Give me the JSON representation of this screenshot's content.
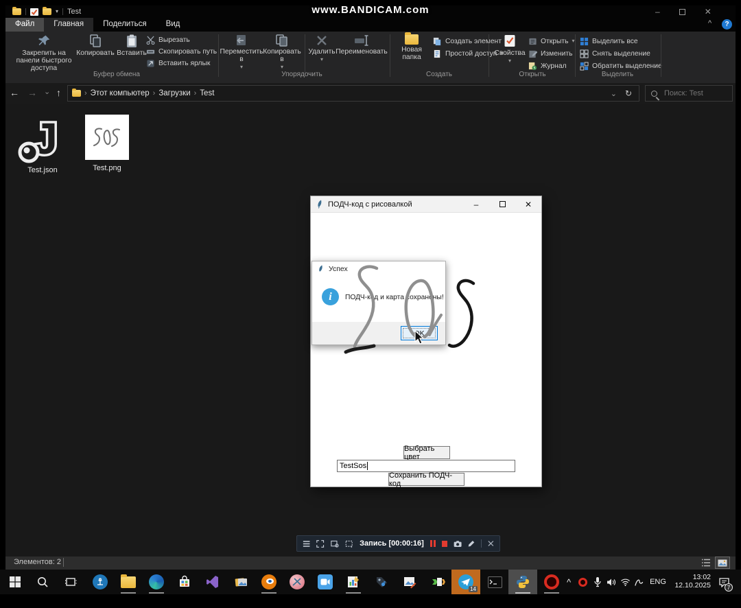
{
  "icons": {
    "minimize": "–",
    "close": "✕",
    "dropdown": "▾",
    "back": "←",
    "forward": "→",
    "up": "↑",
    "refresh": "↻",
    "crumb_sep": "›",
    "help": "?",
    "info": "i",
    "chevron_up": "^",
    "chevron_down": "⌄",
    "json_glyph": "J"
  },
  "titlebar": {
    "title": "Test",
    "watermark": "www.BANDICAM.com"
  },
  "tabs": {
    "file": "Файл",
    "home": "Главная",
    "share": "Поделиться",
    "view": "Вид"
  },
  "ribbon": {
    "groups": [
      {
        "label": "Буфер обмена",
        "buttons": {
          "pin": "Закрепить на панели быстрого доступа",
          "copy": "Копировать",
          "paste": "Вставить",
          "cut": "Вырезать",
          "copy_path": "Скопировать путь",
          "paste_shortcut": "Вставить ярлык"
        }
      },
      {
        "label": "Упорядочить",
        "buttons": {
          "move_to": "Переместить в",
          "copy_to": "Копировать в",
          "delete": "Удалить",
          "rename": "Переименовать"
        }
      },
      {
        "label": "Создать",
        "buttons": {
          "new_folder": "Новая папка",
          "new_item": "Создать элемент",
          "easy_access": "Простой доступ"
        }
      },
      {
        "label": "Открыть",
        "buttons": {
          "properties": "Свойства",
          "open": "Открыть",
          "edit": "Изменить",
          "history": "Журнал"
        }
      },
      {
        "label": "Выделить",
        "buttons": {
          "select_all": "Выделить все",
          "select_none": "Снять выделение",
          "invert": "Обратить выделение"
        }
      }
    ]
  },
  "addressbar": {
    "crumbs": [
      "Этот компьютер",
      "Загрузки",
      "Test"
    ],
    "search_placeholder": "Поиск: Test"
  },
  "files": [
    {
      "name": "Test.json"
    },
    {
      "name": "Test.png",
      "thumb_text": "SOS"
    }
  ],
  "app": {
    "title": "ПОДЧ-код с рисовалкой",
    "drawing_text": "SOS",
    "color_button": "Выбрать цвет",
    "input_value": "TestSos",
    "save_button": "Сохранить ПОДЧ-код",
    "dialog": {
      "title": "Успех",
      "message": "ПОДЧ-код и карта сохранены!",
      "ok": "OK"
    }
  },
  "bandicam": {
    "status": "Запись [00:00:16]"
  },
  "statusbar": {
    "items": "Элементов: 2"
  },
  "taskbar": {
    "telegram_badge": "14",
    "tray": {
      "lang": "ENG",
      "time": "13:02",
      "date": "12.10.2025",
      "notif_badge": "7"
    }
  }
}
